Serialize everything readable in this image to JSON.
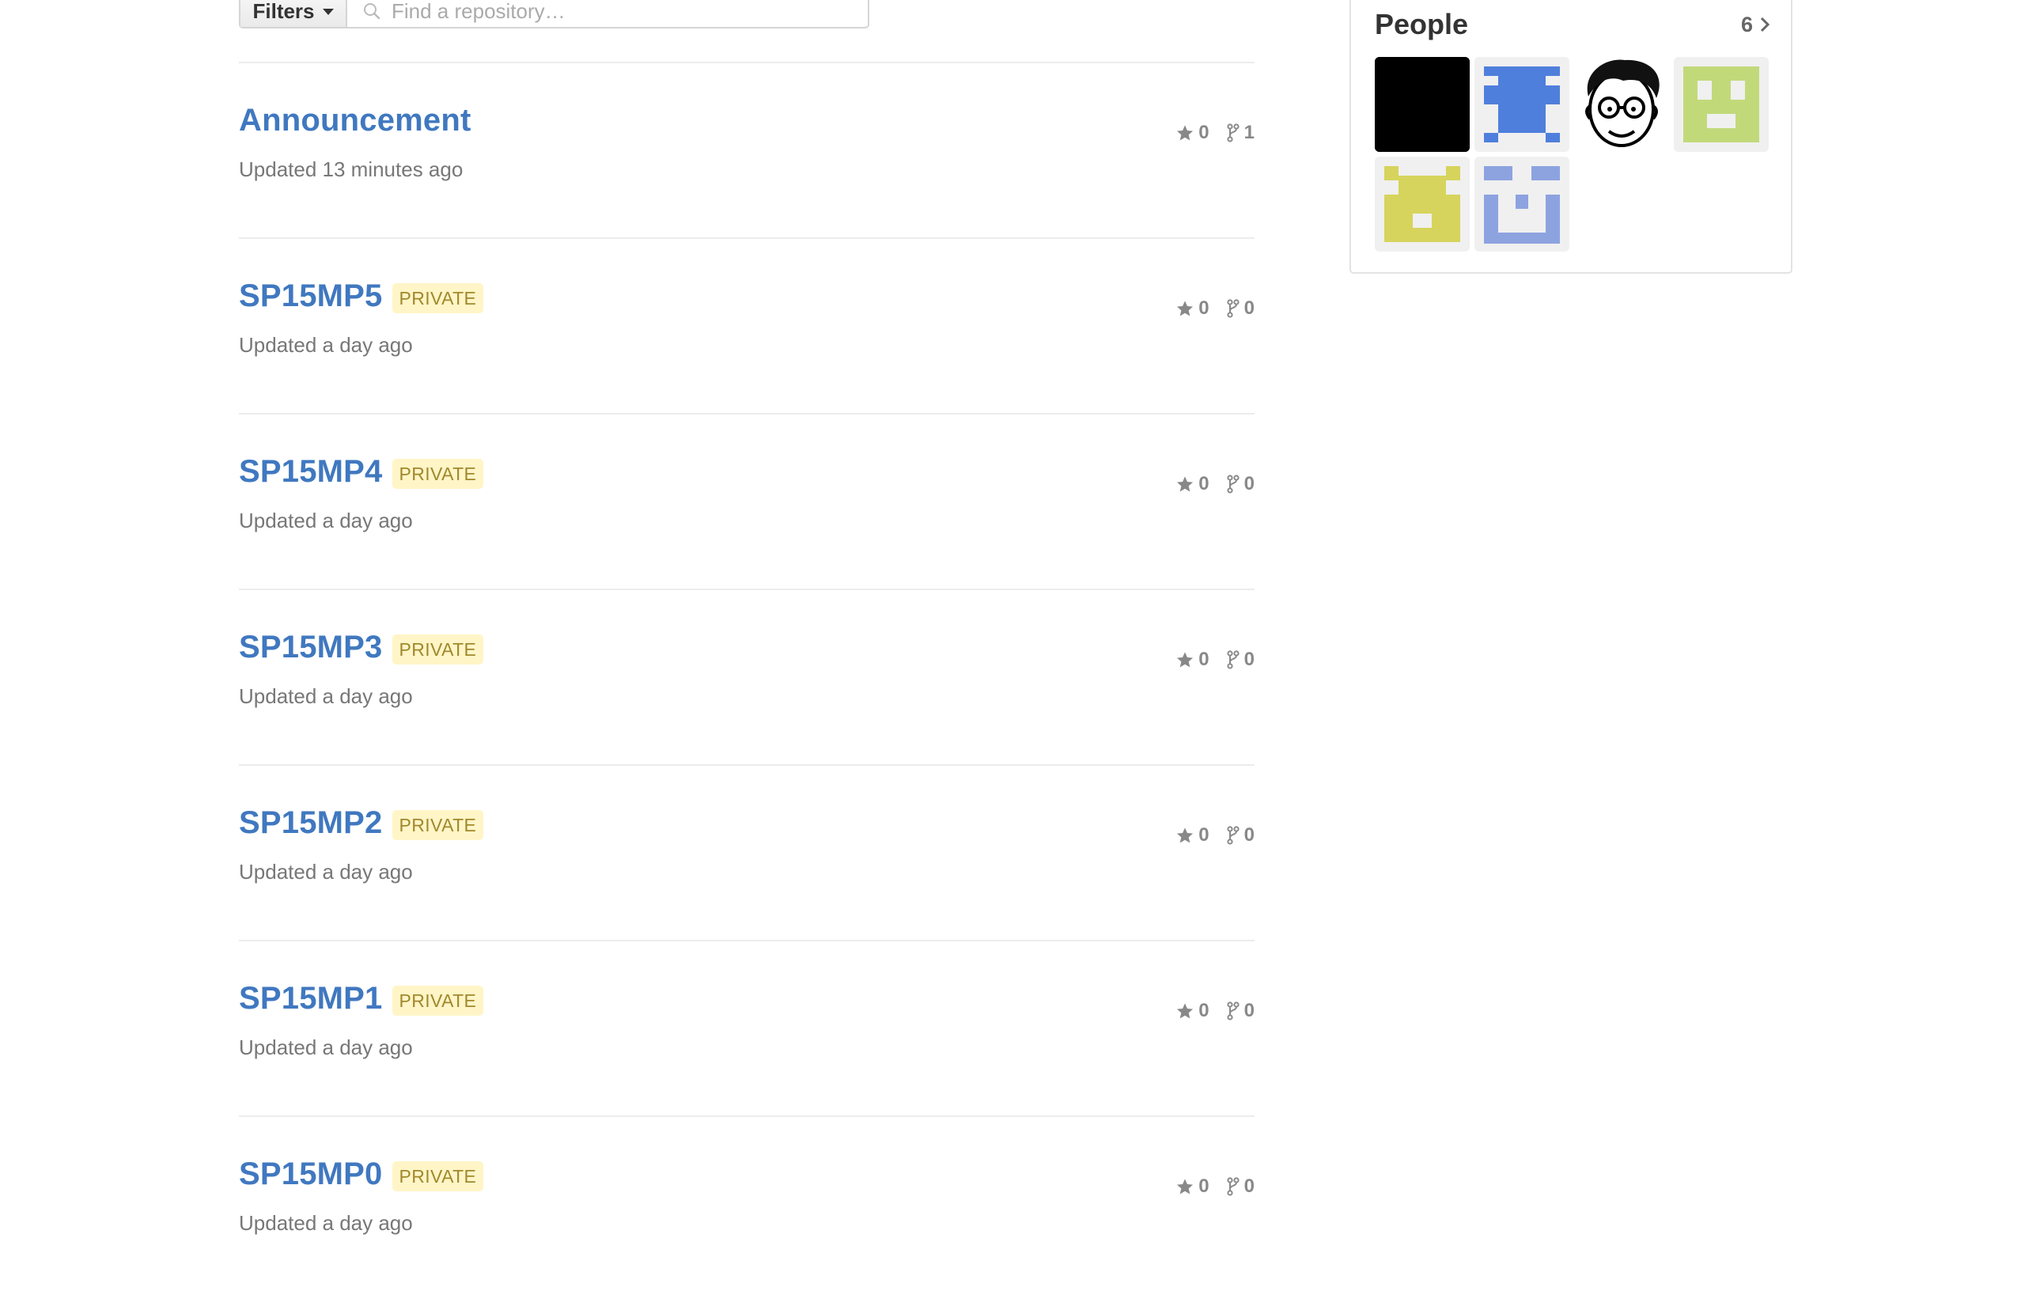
{
  "filters": {
    "button_label": "Filters",
    "search_placeholder": "Find a repository…"
  },
  "repositories": [
    {
      "name": "Announcement",
      "badge": "",
      "updated": "Updated 13 minutes ago",
      "stars": "0",
      "forks": "1"
    },
    {
      "name": "SP15MP5",
      "badge": "PRIVATE",
      "updated": "Updated a day ago",
      "stars": "0",
      "forks": "0"
    },
    {
      "name": "SP15MP4",
      "badge": "PRIVATE",
      "updated": "Updated a day ago",
      "stars": "0",
      "forks": "0"
    },
    {
      "name": "SP15MP3",
      "badge": "PRIVATE",
      "updated": "Updated a day ago",
      "stars": "0",
      "forks": "0"
    },
    {
      "name": "SP15MP2",
      "badge": "PRIVATE",
      "updated": "Updated a day ago",
      "stars": "0",
      "forks": "0"
    },
    {
      "name": "SP15MP1",
      "badge": "PRIVATE",
      "updated": "Updated a day ago",
      "stars": "0",
      "forks": "0"
    },
    {
      "name": "SP15MP0",
      "badge": "PRIVATE",
      "updated": "Updated a day ago",
      "stars": "0",
      "forks": "0"
    }
  ],
  "people": {
    "title": "People",
    "count": "6",
    "avatars": [
      {
        "kind": "solid-black-avatar",
        "color": "#000000"
      },
      {
        "kind": "identicon-avatar",
        "color": "#4f7fdc"
      },
      {
        "kind": "cartoon-face-avatar",
        "color": "#000000"
      },
      {
        "kind": "identicon-avatar",
        "color": "#c2d97a"
      },
      {
        "kind": "identicon-avatar",
        "color": "#d6d45c"
      },
      {
        "kind": "identicon-avatar",
        "color": "#8da3e0"
      }
    ]
  },
  "colors": {
    "link": "#4078c0",
    "badge_bg": "#fff5c7",
    "badge_text": "#a1882b",
    "muted": "#777777"
  },
  "icons": {
    "search": "search-icon",
    "star": "star-icon",
    "fork": "fork-icon",
    "chevron": "chevron-right-icon",
    "caret": "caret-down-icon"
  }
}
